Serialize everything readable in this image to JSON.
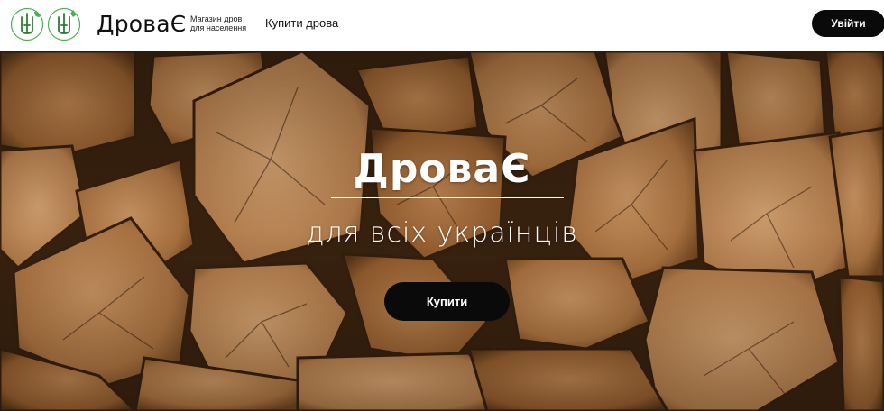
{
  "header": {
    "brand_name": "ДроваЄ",
    "tagline_line1": "Магазин дров",
    "tagline_line2": "для населення",
    "nav_buy_label": "Купити дрова",
    "login_label": "Увійти",
    "emblem_icons": [
      "trident-emblem-icon",
      "trident-emblem-icon"
    ]
  },
  "hero": {
    "title": "ДроваЄ",
    "subtitle": "для всіх українців",
    "buy_label": "Купити",
    "background": "stacked-firewood-logs"
  },
  "colors": {
    "accent_green": "#4caf50",
    "button_black": "#0a0a0a",
    "wood_brown": "#b97a45"
  }
}
